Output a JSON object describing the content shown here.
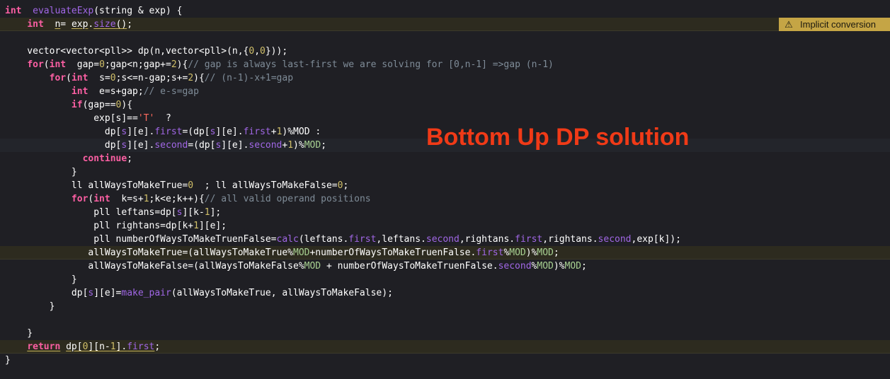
{
  "overlay": {
    "title": "Bottom Up DP solution"
  },
  "warning": {
    "icon": "warning-triangle-icon",
    "glyph": "⚠",
    "text": "Implicit conversion"
  },
  "colors": {
    "background": "#1f1f24",
    "keyword": "#fc5fa3",
    "function": "#a167e6",
    "number": "#d0bf69",
    "string": "#fc6a5d",
    "comment": "#7f8c98",
    "macro": "#a8d192",
    "highlight": "#2d2b1f",
    "overlay": "#f03a17"
  },
  "code": [
    {
      "hl": false,
      "t": [
        [
          "kw",
          "int"
        ],
        [
          "",
          "  "
        ],
        [
          "fn",
          "evaluateExp"
        ],
        [
          "",
          "(string & exp) {"
        ]
      ]
    },
    {
      "hl": true,
      "t": [
        [
          "",
          "    "
        ],
        [
          "kw",
          "int"
        ],
        [
          "",
          "  "
        ],
        [
          "ul",
          "n"
        ],
        [
          "",
          "= "
        ],
        [
          "ul",
          "exp"
        ],
        [
          "",
          "."
        ],
        [
          "fn ul",
          "size"
        ],
        [
          "ul",
          "()"
        ],
        [
          "",
          ";"
        ]
      ]
    },
    {
      "hl": false,
      "t": [
        [
          "",
          ""
        ]
      ]
    },
    {
      "hl": false,
      "t": [
        [
          "",
          "    vector<vector<pll>> dp(n,vector<pll>(n,{"
        ],
        [
          "num",
          "0"
        ],
        [
          "",
          ","
        ],
        [
          "num",
          "0"
        ],
        [
          "",
          "}));"
        ]
      ]
    },
    {
      "hl": false,
      "t": [
        [
          "",
          "    "
        ],
        [
          "kw",
          "for"
        ],
        [
          "",
          "("
        ],
        [
          "kw",
          "int"
        ],
        [
          "",
          "  gap="
        ],
        [
          "num",
          "0"
        ],
        [
          "",
          ";gap<n;gap+="
        ],
        [
          "num",
          "2"
        ],
        [
          "",
          "){"
        ],
        [
          "com",
          "// gap is always last-first we are solving for [0,n-1] =>gap (n-1)"
        ]
      ]
    },
    {
      "hl": false,
      "t": [
        [
          "",
          "        "
        ],
        [
          "kw",
          "for"
        ],
        [
          "",
          "("
        ],
        [
          "kw",
          "int"
        ],
        [
          "",
          "  s="
        ],
        [
          "num",
          "0"
        ],
        [
          "",
          ";s<=n-gap;s+="
        ],
        [
          "num",
          "2"
        ],
        [
          "",
          "){"
        ],
        [
          "com",
          "// (n-1)-x+1=gap"
        ]
      ]
    },
    {
      "hl": false,
      "t": [
        [
          "",
          "            "
        ],
        [
          "kw",
          "int"
        ],
        [
          "",
          "  e=s+gap;"
        ],
        [
          "com",
          "// e-s=gap"
        ]
      ]
    },
    {
      "hl": false,
      "t": [
        [
          "",
          "            "
        ],
        [
          "kw",
          "if"
        ],
        [
          "",
          "(gap=="
        ],
        [
          "num",
          "0"
        ],
        [
          "",
          "){"
        ]
      ]
    },
    {
      "hl": false,
      "t": [
        [
          "",
          "                exp[s]=="
        ],
        [
          "str",
          "'T'"
        ],
        [
          "",
          "  ?"
        ]
      ]
    },
    {
      "hl": false,
      "t": [
        [
          "",
          "                  dp["
        ],
        [
          "mem",
          "s"
        ],
        [
          "",
          "][e]."
        ],
        [
          "mem",
          "first"
        ],
        [
          "",
          "=(dp["
        ],
        [
          "mem",
          "s"
        ],
        [
          "",
          "][e]."
        ],
        [
          "mem",
          "first"
        ],
        [
          "",
          "+"
        ],
        [
          "num",
          "1"
        ],
        [
          "",
          ")%MOD :"
        ]
      ]
    },
    {
      "hl": false,
      "cur": true,
      "t": [
        [
          "",
          "                  dp["
        ],
        [
          "mem",
          "s"
        ],
        [
          "",
          "][e]."
        ],
        [
          "mem",
          "second"
        ],
        [
          "",
          "=(dp["
        ],
        [
          "mem",
          "s"
        ],
        [
          "",
          "][e]."
        ],
        [
          "mem",
          "second"
        ],
        [
          "",
          "+"
        ],
        [
          "num",
          "1"
        ],
        [
          "",
          ")%"
        ],
        [
          "mac",
          "MOD"
        ],
        [
          "",
          ";"
        ]
      ]
    },
    {
      "hl": false,
      "t": [
        [
          "",
          "              "
        ],
        [
          "kw",
          "continue"
        ],
        [
          "",
          ";"
        ]
      ]
    },
    {
      "hl": false,
      "t": [
        [
          "",
          "            }"
        ]
      ]
    },
    {
      "hl": false,
      "t": [
        [
          "",
          "            ll allWaysToMakeTrue="
        ],
        [
          "num",
          "0"
        ],
        [
          "",
          "  ; ll allWaysToMakeFalse="
        ],
        [
          "num",
          "0"
        ],
        [
          "",
          ";"
        ]
      ]
    },
    {
      "hl": false,
      "t": [
        [
          "",
          "            "
        ],
        [
          "kw",
          "for"
        ],
        [
          "",
          "("
        ],
        [
          "kw",
          "int"
        ],
        [
          "",
          "  k=s+"
        ],
        [
          "num",
          "1"
        ],
        [
          "",
          ";k<e;k++){"
        ],
        [
          "com",
          "// all valid operand positions"
        ]
      ]
    },
    {
      "hl": false,
      "t": [
        [
          "",
          "                pll leftans=dp["
        ],
        [
          "mem",
          "s"
        ],
        [
          "",
          "][k-"
        ],
        [
          "num",
          "1"
        ],
        [
          "",
          "];"
        ]
      ]
    },
    {
      "hl": false,
      "t": [
        [
          "",
          "                pll rightans=dp[k+"
        ],
        [
          "num",
          "1"
        ],
        [
          "",
          "][e];"
        ]
      ]
    },
    {
      "hl": false,
      "t": [
        [
          "",
          "                pll numberOfWaysToMakeTruenFalse="
        ],
        [
          "fn",
          "calc"
        ],
        [
          "",
          "(leftans."
        ],
        [
          "mem",
          "first"
        ],
        [
          "",
          ",leftans."
        ],
        [
          "mem",
          "second"
        ],
        [
          "",
          ",rightans."
        ],
        [
          "mem",
          "first"
        ],
        [
          "",
          ",rightans."
        ],
        [
          "mem",
          "second"
        ],
        [
          "",
          ",exp[k]);"
        ]
      ]
    },
    {
      "hl": true,
      "t": [
        [
          "",
          "               allWaysToMakeTrue=(allWaysToMakeTrue%"
        ],
        [
          "mac",
          "MOD"
        ],
        [
          "",
          "+numberOfWaysToMakeTruenFalse."
        ],
        [
          "mem",
          "first"
        ],
        [
          "",
          "%"
        ],
        [
          "mac",
          "MOD"
        ],
        [
          "",
          ")%"
        ],
        [
          "mac",
          "MOD"
        ],
        [
          "",
          ";"
        ]
      ]
    },
    {
      "hl": false,
      "t": [
        [
          "",
          "               allWaysToMakeFalse=(allWaysToMakeFalse%"
        ],
        [
          "mac",
          "MOD"
        ],
        [
          "",
          " + numberOfWaysToMakeTruenFalse."
        ],
        [
          "mem",
          "second"
        ],
        [
          "",
          "%"
        ],
        [
          "mac",
          "MOD"
        ],
        [
          "",
          ")%"
        ],
        [
          "mac",
          "MOD"
        ],
        [
          "",
          ";"
        ]
      ]
    },
    {
      "hl": false,
      "t": [
        [
          "",
          "            }"
        ]
      ]
    },
    {
      "hl": false,
      "t": [
        [
          "",
          "            dp["
        ],
        [
          "mem",
          "s"
        ],
        [
          "",
          "][e]="
        ],
        [
          "fn",
          "make_pair"
        ],
        [
          "",
          "(allWaysToMakeTrue, allWaysToMakeFalse);"
        ]
      ]
    },
    {
      "hl": false,
      "t": [
        [
          "",
          "        }"
        ]
      ]
    },
    {
      "hl": false,
      "t": [
        [
          "",
          ""
        ]
      ]
    },
    {
      "hl": false,
      "t": [
        [
          "",
          "    }"
        ]
      ]
    },
    {
      "hl": true,
      "t": [
        [
          "",
          "    "
        ],
        [
          "kw ul",
          "return"
        ],
        [
          "",
          " "
        ],
        [
          "ul",
          "dp["
        ],
        [
          "num ul",
          "0"
        ],
        [
          "ul",
          "]["
        ],
        [
          "ul",
          "n-"
        ],
        [
          "num ul",
          "1"
        ],
        [
          "ul",
          "]."
        ],
        [
          "mem ul",
          "first"
        ],
        [
          "",
          ";"
        ]
      ]
    },
    {
      "hl": false,
      "t": [
        [
          "",
          "}"
        ]
      ]
    }
  ]
}
